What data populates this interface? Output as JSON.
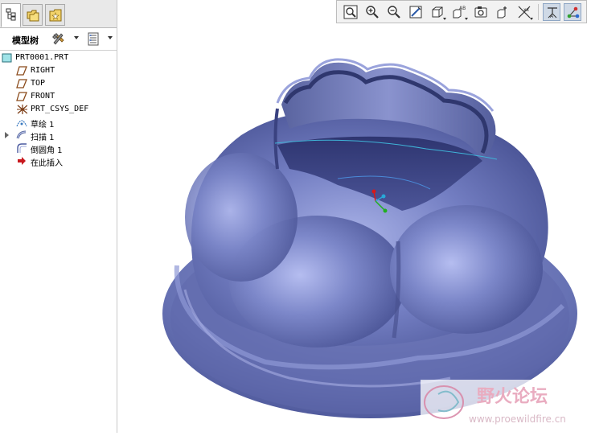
{
  "navigator": {
    "tabs": [
      {
        "name": "model-tree-tab",
        "icon": "model-tree-icon",
        "active": true
      },
      {
        "name": "folder-browser-tab",
        "icon": "folder-icon",
        "active": false
      },
      {
        "name": "favorites-tab",
        "icon": "favorites-icon",
        "active": false
      }
    ],
    "header": {
      "title": "模型树",
      "settings_icon": "tools-icon",
      "show_icon": "tree-columns-icon"
    },
    "tree": [
      {
        "label": "PRT0001.PRT",
        "icon": "part-icon"
      },
      {
        "label": "RIGHT",
        "icon": "datum-plane-icon"
      },
      {
        "label": "TOP",
        "icon": "datum-plane-icon"
      },
      {
        "label": "FRONT",
        "icon": "datum-plane-icon"
      },
      {
        "label": "PRT_CSYS_DEF",
        "icon": "csys-icon"
      },
      {
        "label": "草绘 1",
        "icon": "sketch-icon"
      },
      {
        "label": "扫描 1",
        "icon": "sweep-icon"
      },
      {
        "label": "倒圆角 1",
        "icon": "round-icon"
      },
      {
        "label": "在此插入",
        "icon": "insert-here-icon"
      }
    ]
  },
  "toolbar": {
    "buttons": [
      {
        "name": "refit-button",
        "icon": "refit-icon"
      },
      {
        "name": "zoom-in-button",
        "icon": "zoom-in-icon"
      },
      {
        "name": "zoom-out-button",
        "icon": "zoom-out-icon"
      },
      {
        "name": "repaint-button",
        "icon": "repaint-icon"
      },
      {
        "name": "display-style-button",
        "icon": "shaded-cube-icon"
      },
      {
        "name": "saved-views-button",
        "icon": "saved-views-icon"
      },
      {
        "name": "view-manager-button",
        "icon": "view-manager-icon"
      },
      {
        "name": "perspective-button",
        "icon": "perspective-icon"
      },
      {
        "name": "datum-display-button",
        "icon": "datum-display-icon"
      },
      {
        "name": "annotation-display-button",
        "icon": "annotation-display-icon"
      },
      {
        "name": "spin-center-button",
        "icon": "spin-center-icon"
      }
    ]
  },
  "viewport": {
    "model_color": "#6b75b5",
    "watermark": {
      "title": "野火论坛",
      "url": "www.proewildfire.cn"
    }
  }
}
